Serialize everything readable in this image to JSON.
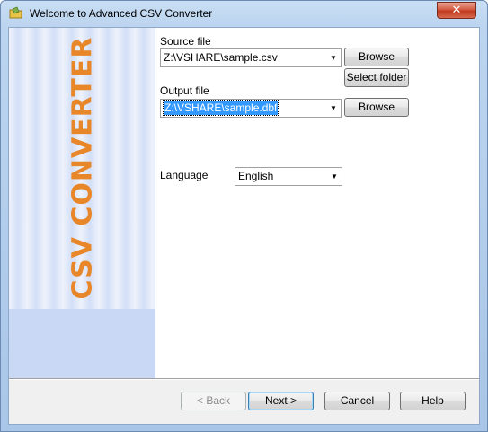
{
  "window": {
    "title": "Welcome to Advanced CSV Converter",
    "close_glyph": "✕"
  },
  "side_panel": {
    "label": "CSV CONVERTER",
    "accent_color": "#e8862a"
  },
  "source": {
    "label": "Source file",
    "value": "Z:\\VSHARE\\sample.csv",
    "browse_label": "Browse",
    "select_folder_label": "Select folder"
  },
  "output": {
    "label": "Output file",
    "value": "Z:\\VSHARE\\sample.dbf",
    "browse_label": "Browse"
  },
  "language": {
    "label": "Language",
    "value": "English"
  },
  "footer": {
    "back_label": "< Back",
    "next_label": "Next >",
    "cancel_label": "Cancel",
    "help_label": "Help"
  },
  "icons": {
    "app": "folder-icon",
    "dropdown": "chevron-down-icon"
  }
}
